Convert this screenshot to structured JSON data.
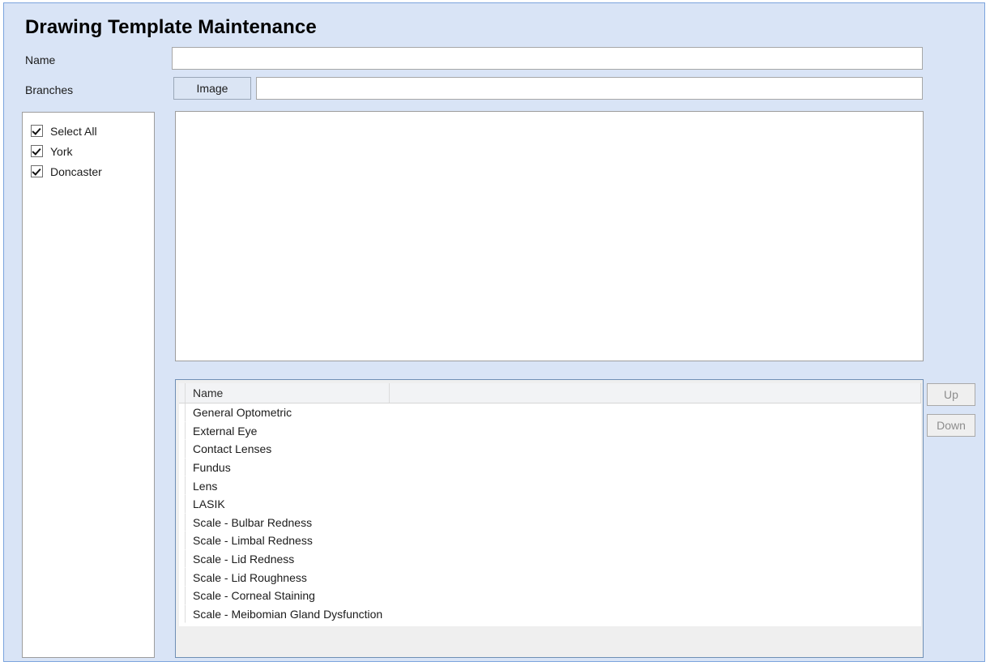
{
  "window": {
    "title": "Drawing Template Maintenance",
    "accent_border": "#7ba3dd",
    "panel_background": "#d9e4f6"
  },
  "form": {
    "name_label": "Name",
    "name_value": "",
    "name_placeholder": "",
    "branches_label": "Branches",
    "image_button_label": "Image",
    "image_value": "",
    "image_placeholder": ""
  },
  "branches": {
    "items": [
      {
        "label": "Select All",
        "checked": true
      },
      {
        "label": "York",
        "checked": true
      },
      {
        "label": "Doncaster",
        "checked": true
      }
    ]
  },
  "preview": {
    "content": ""
  },
  "grid": {
    "columns": [
      "Name",
      ""
    ],
    "rows": [
      {
        "name": "General Optometric"
      },
      {
        "name": "External Eye"
      },
      {
        "name": "Contact Lenses"
      },
      {
        "name": "Fundus"
      },
      {
        "name": "Lens"
      },
      {
        "name": "LASIK"
      },
      {
        "name": "Scale - Bulbar Redness"
      },
      {
        "name": "Scale - Limbal Redness"
      },
      {
        "name": "Scale - Lid Redness"
      },
      {
        "name": "Scale - Lid Roughness"
      },
      {
        "name": "Scale - Corneal Staining"
      },
      {
        "name": "Scale - Meibomian Gland Dysfunction"
      }
    ]
  },
  "order_controls": {
    "up_label": "Up",
    "down_label": "Down"
  }
}
